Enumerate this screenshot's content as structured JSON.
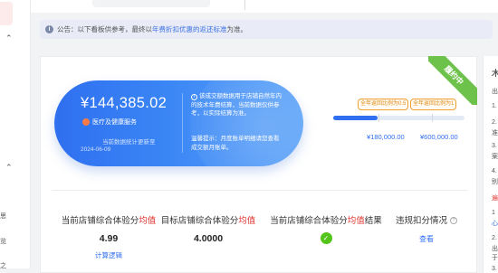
{
  "sidebar": {
    "chevrons": [
      "⌃",
      "⌃"
    ],
    "chars": [
      "思",
      "览",
      "之"
    ]
  },
  "notice": {
    "prefix": "公告：以下看板供参考，最终以",
    "link": "年费折扣优惠的返还标准",
    "suffix": "为准。"
  },
  "ribbon": "履约中",
  "hero": {
    "amount": "¥144,385.02",
    "service": "医疗及健康服务",
    "hint_line1": "当前数据统计更新至",
    "hint_line2": "2024-06-09",
    "desc": "该成交额数据用于店铺自然年内的技术年费结算，当前数据仅供参考，以实际结算为准。",
    "tip": "温馨提示：月度账单明细请您查看成交额月账单。"
  },
  "progress": {
    "fraction": 0.34,
    "tags": [
      "全年返回比例为0.5",
      "全年返回比例为1"
    ],
    "amounts": [
      "¥180,000.00",
      "¥600,000.00"
    ]
  },
  "metrics": [
    {
      "pre": "当前店铺综合体验分",
      "hl": "均值",
      "post": "",
      "value": "4.99",
      "link": "计算逻辑"
    },
    {
      "pre": "目标店铺综合体验分",
      "hl": "均值",
      "post": "",
      "value": "4.0000"
    },
    {
      "pre": "当前店铺综合体验分",
      "hl": "均值",
      "post": "结果",
      "result": "✓"
    },
    {
      "pre": "违规扣分情况",
      "hl": "",
      "post": "",
      "action": "查看",
      "q": "?"
    }
  ],
  "right_panel": {
    "lines": [
      "木",
      "出",
      "1.",
      "2.",
      "准",
      "3.",
      "案",
      "4.",
      "别",
      "遍",
      "1",
      "心",
      "2.",
      "出",
      "于",
      "3."
    ]
  }
}
